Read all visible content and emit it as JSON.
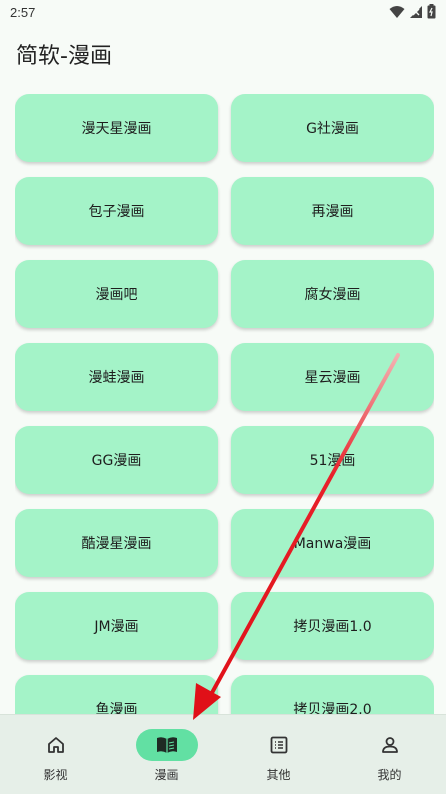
{
  "status": {
    "time": "2:57"
  },
  "header": {
    "title": "简软-漫画"
  },
  "sources": [
    {
      "label": "漫天星漫画"
    },
    {
      "label": "G社漫画"
    },
    {
      "label": "包子漫画"
    },
    {
      "label": "再漫画"
    },
    {
      "label": "漫画吧"
    },
    {
      "label": "腐女漫画"
    },
    {
      "label": "漫蛙漫画"
    },
    {
      "label": "星云漫画"
    },
    {
      "label": "GG漫画"
    },
    {
      "label": "51漫画"
    },
    {
      "label": "酷漫星漫画"
    },
    {
      "label": "Manwa漫画"
    },
    {
      "label": "JM漫画"
    },
    {
      "label": "拷贝漫画1.0"
    },
    {
      "label": "鱼漫画"
    },
    {
      "label": "拷贝漫画2.0"
    }
  ],
  "nav": [
    {
      "label": "影视",
      "icon": "home-icon",
      "active": false
    },
    {
      "label": "漫画",
      "icon": "book-icon",
      "active": true
    },
    {
      "label": "其他",
      "icon": "list-icon",
      "active": false
    },
    {
      "label": "我的",
      "icon": "person-icon",
      "active": false
    }
  ],
  "colors": {
    "tile": "#a4f3c8",
    "active_pill": "#62e0a3",
    "arrow": "#e8202a"
  }
}
